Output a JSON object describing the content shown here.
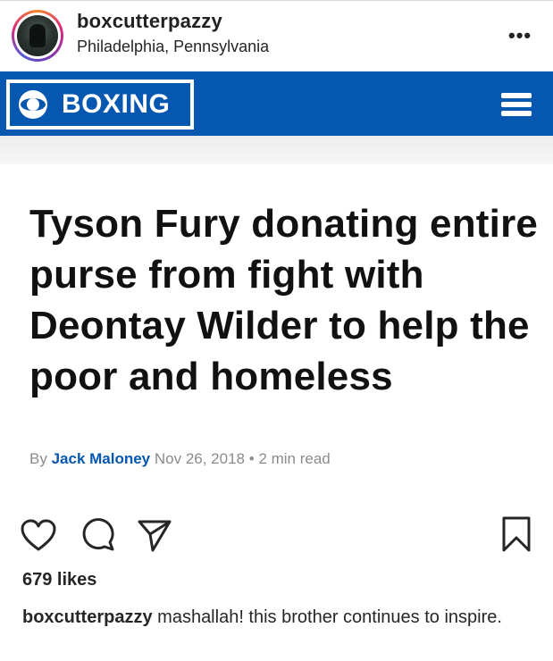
{
  "post_header": {
    "username": "boxcutterpazzy",
    "location": "Philadelphia, Pennsylvania",
    "more_label": "•••"
  },
  "cbs_nav": {
    "brand_label": "BOXING",
    "brand_color": "#0657b0"
  },
  "article": {
    "headline": "Tyson Fury donating entire purse from fight with Deontay Wilder to help the poor and homeless",
    "byline_prefix": "By",
    "author": "Jack Maloney",
    "date": "Nov 26, 2018",
    "separator": "•",
    "read_time": "2 min read"
  },
  "post_actions": {
    "icons": [
      "heart-icon",
      "comment-icon",
      "share-icon",
      "bookmark-icon"
    ],
    "likes": "679 likes"
  },
  "caption": {
    "username": "boxcutterpazzy",
    "text": "mashallah! this brother continues to inspire."
  }
}
